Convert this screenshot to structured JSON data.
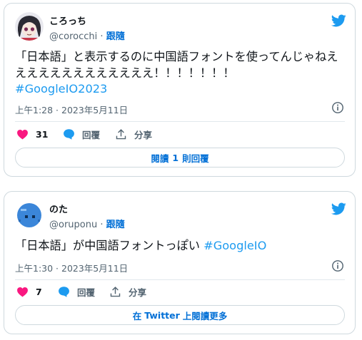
{
  "tweets": [
    {
      "author_name": "ころっち",
      "handle": "@corocchi",
      "separator": "·",
      "follow_label": "跟隨",
      "text": "「日本語」と表示するのに中国語フォントを使ってんじゃねえええええええええええええ！！！！！！！",
      "hashtag": "#GoogleIO2023",
      "timestamp": "上午1:28 · 2023年5月11日",
      "like_count": "31",
      "reply_label": "回覆",
      "share_label": "分享",
      "footer_button": {
        "label_pre": "閱讀",
        "label_num": "1",
        "label_post": "則回覆"
      }
    },
    {
      "author_name": "のた",
      "handle": "@oruponu",
      "separator": "·",
      "follow_label": "跟隨",
      "text": "「日本語」が中国語フォントっぽい",
      "hashtag": "#GoogleIO",
      "timestamp": "上午1:30 · 2023年5月11日",
      "like_count": "7",
      "reply_label": "回覆",
      "share_label": "分享",
      "footer_button": {
        "label_pre": "在",
        "label_num": "Twitter",
        "label_post": "上閱讀更多"
      }
    }
  ],
  "colors": {
    "accent": "#1d9bf0",
    "link": "#006fd6",
    "heart": "#f91880",
    "secondary_text": "#536471",
    "border": "#cfd9de"
  },
  "icons": [
    "twitter-bird-icon",
    "heart-icon",
    "reply-bubble-icon",
    "share-icon",
    "info-icon"
  ]
}
